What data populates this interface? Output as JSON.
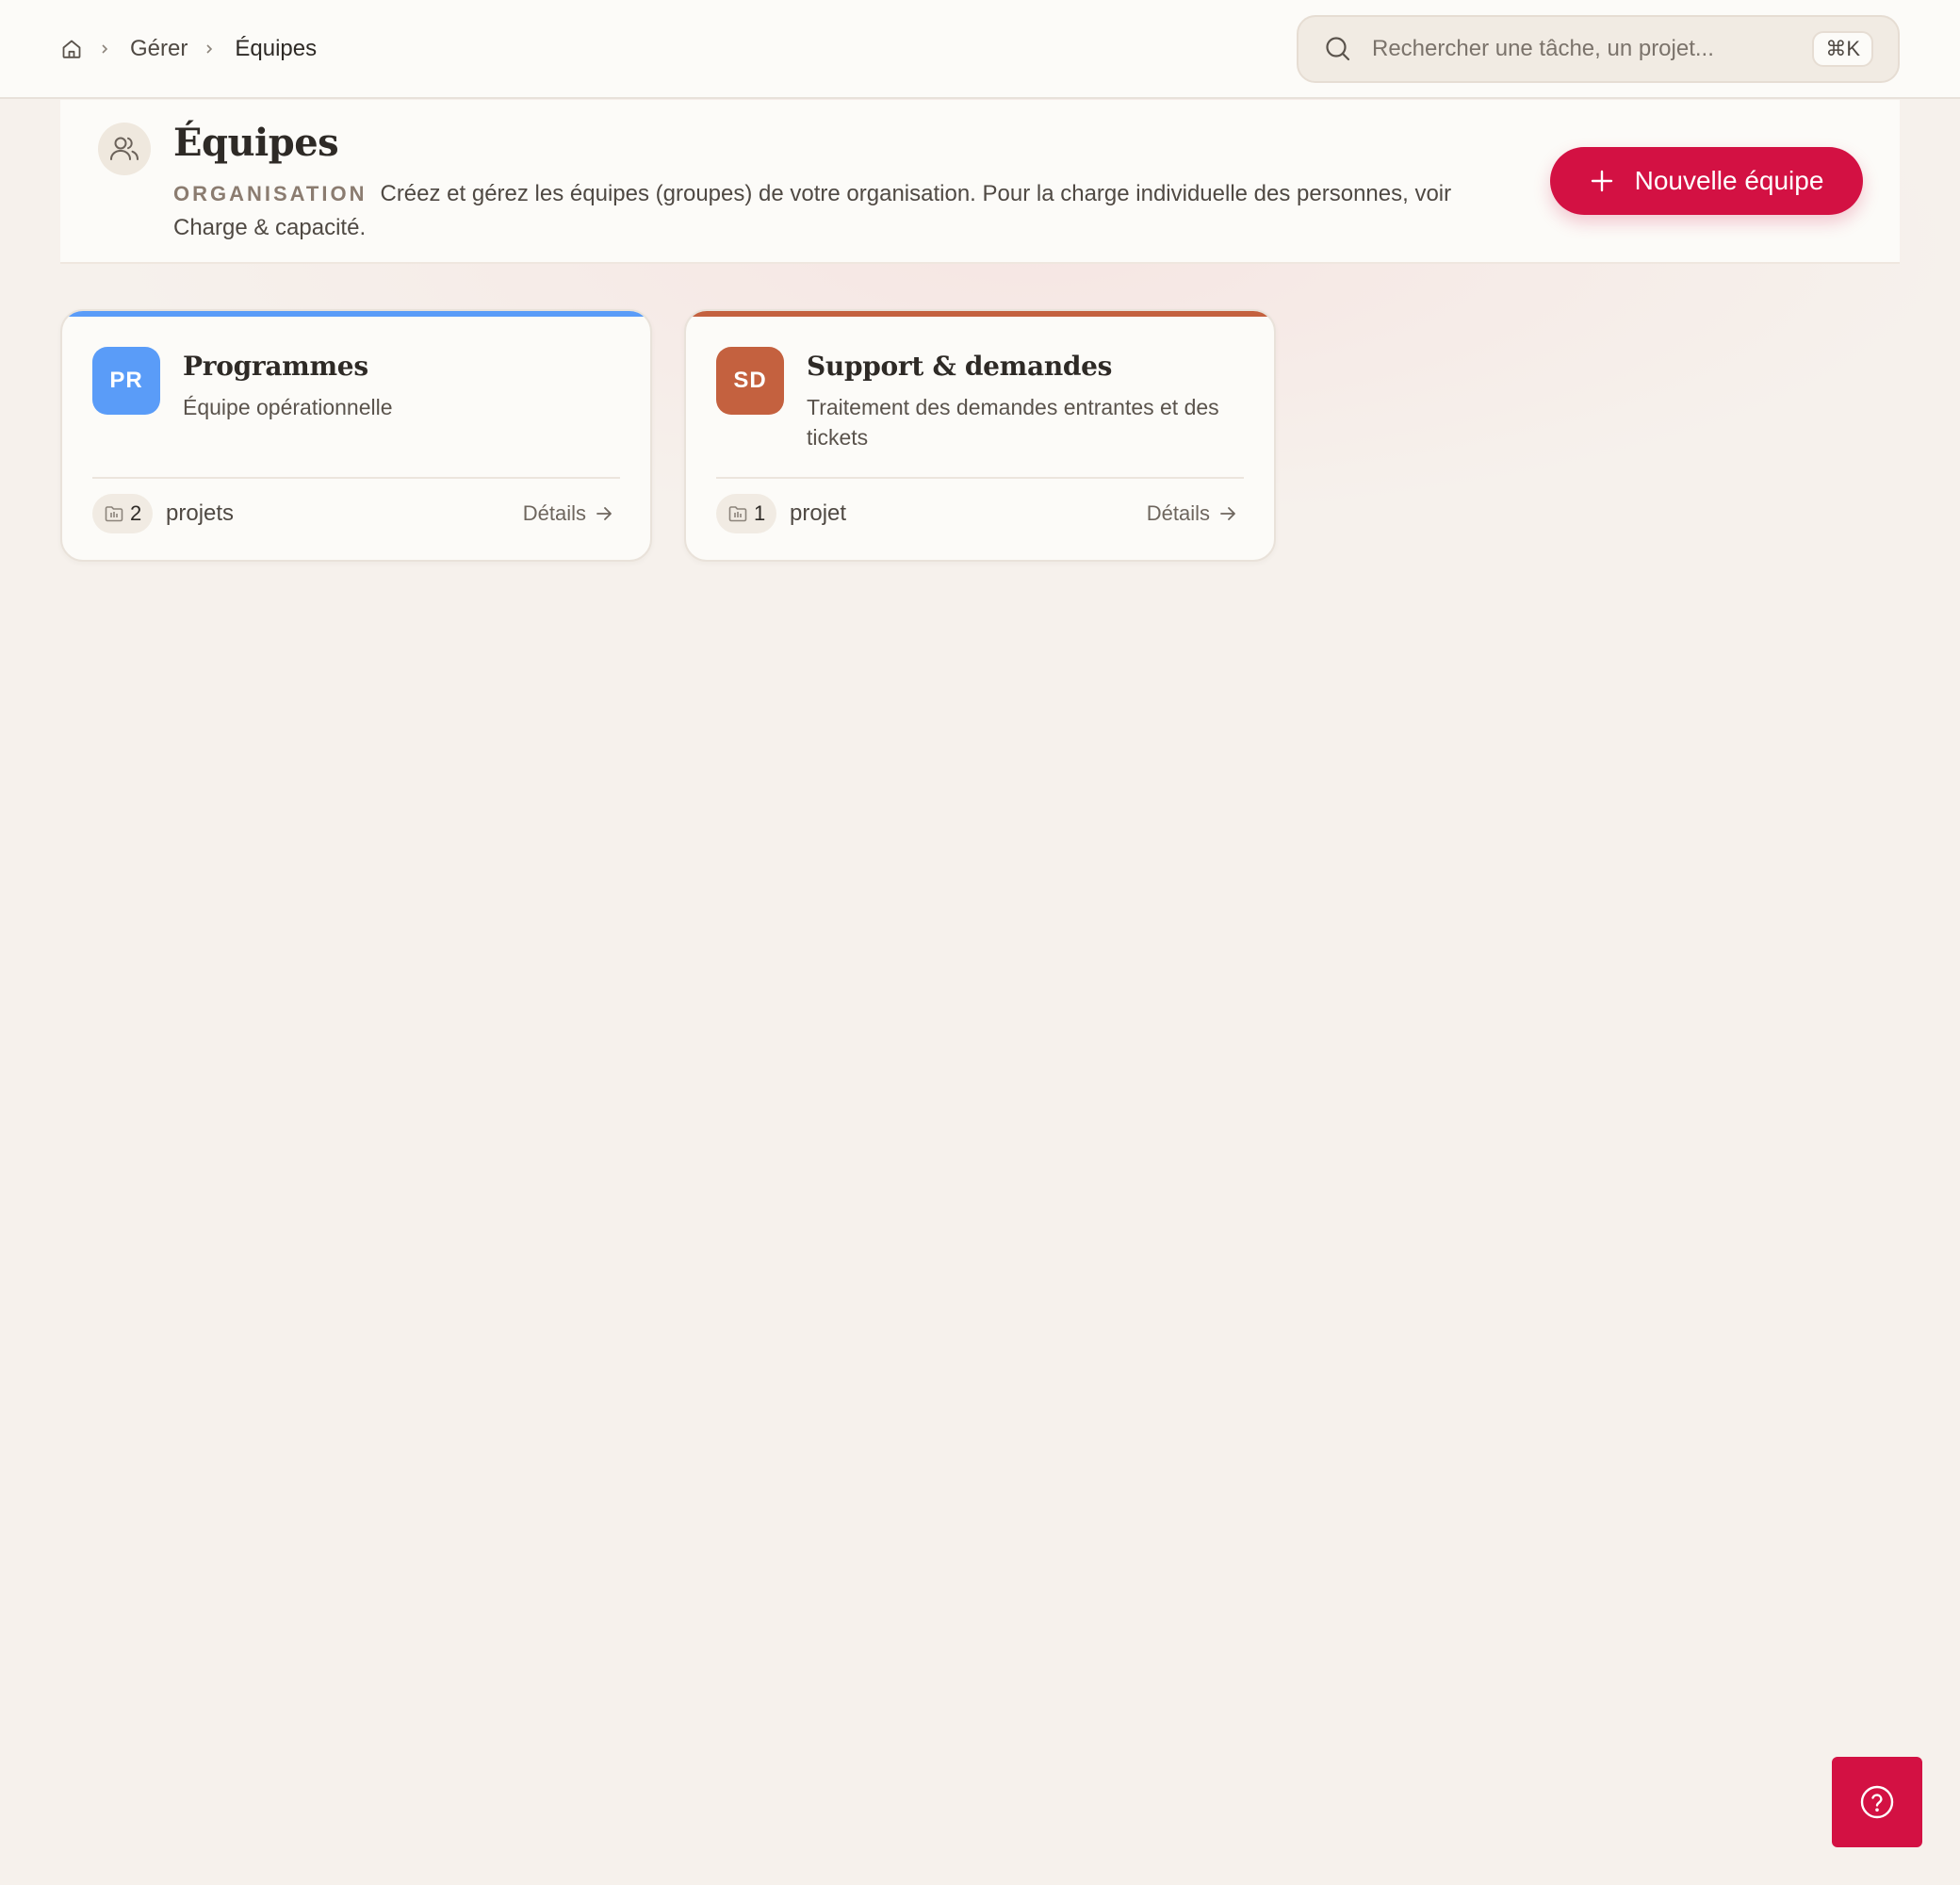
{
  "breadcrumb": {
    "home_icon": "home-icon",
    "items": [
      "Gérer",
      "Équipes"
    ]
  },
  "search": {
    "placeholder": "Rechercher une tâche, un projet...",
    "shortcut": "⌘K"
  },
  "header": {
    "title": "Équipes",
    "eyebrow": "ORGANISATION",
    "description": "Créez et gérez les équipes (groupes) de votre organisation. Pour la charge individuelle des personnes, voir Charge & capacité.",
    "new_button_label": "Nouvelle équipe"
  },
  "teams": [
    {
      "initials": "PR",
      "name": "Programmes",
      "description": "Équipe opérationnelle",
      "project_count": "2",
      "project_label": "projets",
      "details_label": "Détails",
      "color": "#5a9cf8"
    },
    {
      "initials": "SD",
      "name": "Support & demandes",
      "description": "Traitement des demandes entrantes et des tickets",
      "project_count": "1",
      "project_label": "projet",
      "details_label": "Détails",
      "color": "#c4613f"
    }
  ],
  "help": {
    "icon": "help-circle-icon"
  },
  "colors": {
    "accent": "#d31143",
    "background": "#f6f1ec",
    "surface": "#fcfbf8"
  }
}
